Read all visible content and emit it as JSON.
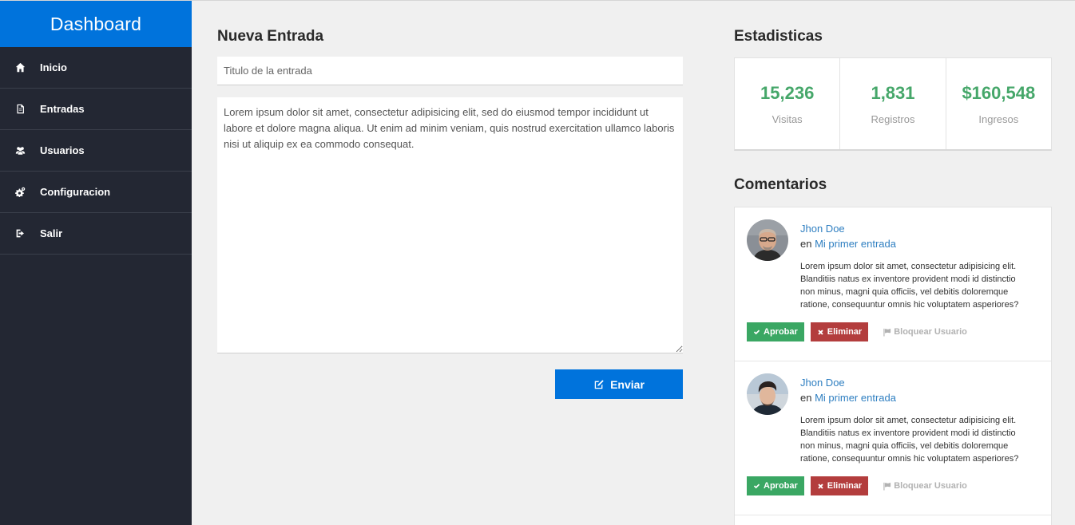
{
  "sidebar": {
    "brand": "Dashboard",
    "items": [
      {
        "label": "Inicio",
        "icon": "home-icon"
      },
      {
        "label": "Entradas",
        "icon": "document-icon"
      },
      {
        "label": "Usuarios",
        "icon": "users-icon"
      },
      {
        "label": "Configuracion",
        "icon": "cogs-icon"
      },
      {
        "label": "Salir",
        "icon": "sign-out-icon"
      }
    ]
  },
  "new_entry": {
    "title": "Nueva Entrada",
    "title_placeholder": "Titulo de la entrada",
    "body": "Lorem ipsum dolor sit amet, consectetur adipisicing elit, sed do eiusmod tempor incididunt ut labore et dolore magna aliqua. Ut enim ad minim veniam, quis nostrud exercitation ullamco laboris nisi ut aliquip ex ea commodo consequat.",
    "submit_label": "Enviar"
  },
  "stats": {
    "title": "Estadisticas",
    "items": [
      {
        "value": "15,236",
        "label": "Visitas"
      },
      {
        "value": "1,831",
        "label": "Registros"
      },
      {
        "value": "$160,548",
        "label": "Ingresos"
      }
    ],
    "accent_color": "#46a76a"
  },
  "comments": {
    "title": "Comentarios",
    "items": [
      {
        "author": "Jhon Doe",
        "on_prefix": "en",
        "post": "Mi primer entrada",
        "text": "Lorem ipsum dolor sit amet, consectetur adipisicing elit. Blanditiis natus ex inventore provident modi id distinctio non minus, magni quia officiis, vel debitis doloremque ratione, consequuntur omnis hic voluptatem asperiores?",
        "approve_label": "Aprobar",
        "delete_label": "Eliminar",
        "block_label": "Bloquear Usuario"
      },
      {
        "author": "Jhon Doe",
        "on_prefix": "en",
        "post": "Mi primer entrada",
        "text": "Lorem ipsum dolor sit amet, consectetur adipisicing elit. Blanditiis natus ex inventore provident modi id distinctio non minus, magni quia officiis, vel debitis doloremque ratione, consequuntur omnis hic voluptatem asperiores?",
        "approve_label": "Aprobar",
        "delete_label": "Eliminar",
        "block_label": "Bloquear Usuario"
      }
    ]
  },
  "colors": {
    "primary": "#0073dc",
    "sidebar_bg": "#232733",
    "approve": "#3aa763",
    "delete": "#b33d3d",
    "link": "#2f7fc1"
  }
}
